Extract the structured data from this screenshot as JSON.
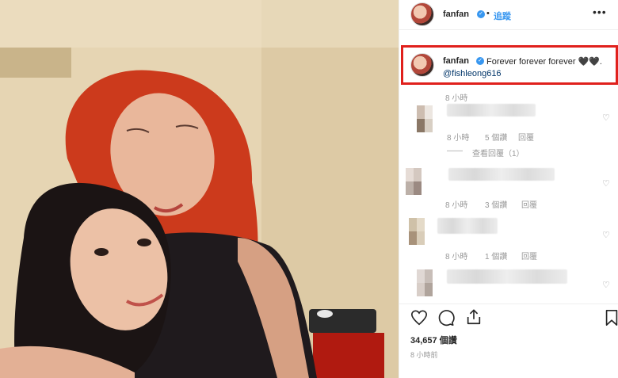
{
  "header": {
    "username": "fanfan",
    "separator": "•",
    "follow_label": "追蹤",
    "more_icon": "•••"
  },
  "caption": {
    "username": "fanfan",
    "text": "Forever forever forever 🖤🖤.",
    "mention": "@fishleong616",
    "time": "8 小時"
  },
  "comments": [
    {
      "time": "8 小時",
      "likes": "5 個讚",
      "reply": "回覆",
      "view_replies": "查看回覆（1）"
    },
    {
      "time": "8 小時",
      "likes": "3 個讚",
      "reply": "回覆"
    },
    {
      "time": "8 小時",
      "likes": "1 個讚",
      "reply": "回覆"
    },
    {}
  ],
  "post": {
    "likes": "34,657 個讚",
    "time_ago": "8 小時前"
  },
  "icons": {
    "like": "heart-icon",
    "comment": "comment-icon",
    "share": "share-icon",
    "save": "bookmark-icon"
  },
  "colors": {
    "link": "#3897f0",
    "highlight_border": "#e0201c",
    "verified": "#3897f0"
  }
}
